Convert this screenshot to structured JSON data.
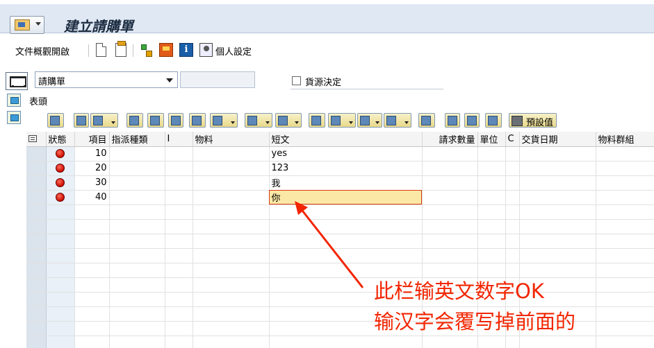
{
  "title": "建立請購單",
  "toolbar": {
    "doc_overview_label": "文件概觀開啟",
    "personal_settings_label": "個人設定",
    "info_glyph": "i"
  },
  "header": {
    "doc_type_value": "請購單",
    "source_determination_label": "貨源決定",
    "source_determination_checked": false,
    "header_label": "表頭"
  },
  "grid_toolbar": {
    "default_values_label": "預設值"
  },
  "grid": {
    "columns": [
      "狀態",
      "項目",
      "指派種類",
      "I",
      "物料",
      "短文",
      "請求數量",
      "單位",
      "C",
      "交貨日期",
      "物料群組"
    ],
    "rows": [
      {
        "status": "error",
        "item": "10",
        "short_text": "yes"
      },
      {
        "status": "error",
        "item": "20",
        "short_text": "123"
      },
      {
        "status": "error",
        "item": "30",
        "short_text": "我"
      },
      {
        "status": "error",
        "item": "40",
        "short_text": "你"
      }
    ],
    "empty_rows": 10,
    "active_cell": {
      "row": 3,
      "column": "短文"
    }
  },
  "annotation": {
    "line1": "此栏输英文数字OK",
    "line2": "输汉字会覆写掉前面的",
    "color": "#f22500"
  }
}
